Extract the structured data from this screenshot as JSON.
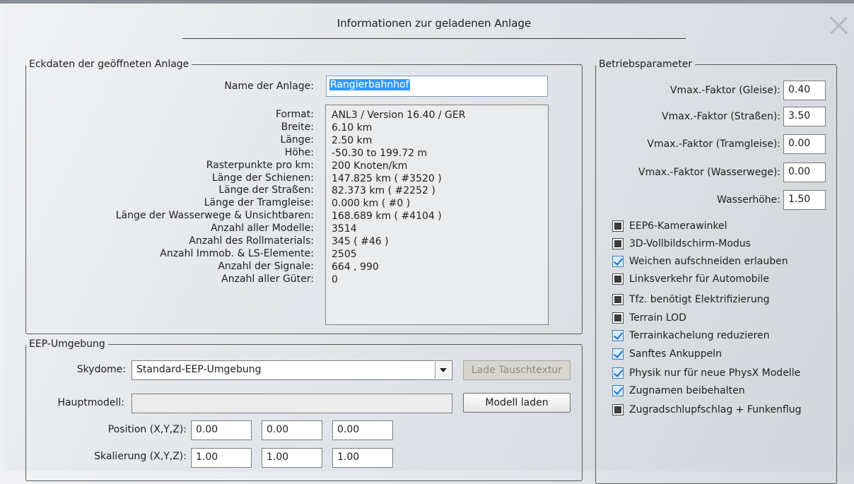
{
  "dialog": {
    "title": "Informationen zur geladenen Anlage"
  },
  "eckdaten": {
    "legend": "Eckdaten der geöffneten Anlage",
    "name_label": "Name der Anlage:",
    "name_value": "Rangierbahnhof",
    "rows": [
      {
        "label": "Format:",
        "value": "ANL3 / Version 16.40 / GER"
      },
      {
        "label": "Breite:",
        "value": "6.10 km"
      },
      {
        "label": "Länge:",
        "value": "2.50 km"
      },
      {
        "label": "Höhe:",
        "value": "-50.30 to 199.72 m"
      },
      {
        "label": "Rasterpunkte pro km:",
        "value": "200 Knoten/km"
      },
      {
        "label": "Länge der Schienen:",
        "value": "147.825 km ( #3520 )"
      },
      {
        "label": "Länge der Straßen:",
        "value": "82.373 km ( #2252 )"
      },
      {
        "label": "Länge der Tramgleise:",
        "value": "0.000 km ( #0 )"
      },
      {
        "label": "Länge der Wasserwege & Unsichtbaren:",
        "value": "168.689 km ( #4104 )"
      },
      {
        "label": "Anzahl aller Modelle:",
        "value": "3514"
      },
      {
        "label": "Anzahl des Rollmaterials:",
        "value": "345 ( #46 )"
      },
      {
        "label": "Anzahl Immob. & LS-Elemente:",
        "value": "2505"
      },
      {
        "label": "Anzahl der Signale:",
        "value": "664 , 990"
      },
      {
        "label": "Anzahl aller Güter:",
        "value": "0"
      }
    ]
  },
  "eep": {
    "legend": "EEP-Umgebung",
    "skydome_label": "Skydome:",
    "skydome_value": "Standard-EEP-Umgebung",
    "lade_button": "Lade Tauschtextur",
    "hauptmodell_label": "Hauptmodell:",
    "hauptmodell_value": "",
    "modell_button": "Modell laden",
    "position_label": "Position (X,Y,Z):",
    "position": [
      "0.00",
      "0.00",
      "0.00"
    ],
    "skalierung_label": "Skalierung (X,Y,Z):",
    "skalierung": [
      "1.00",
      "1.00",
      "1.00"
    ]
  },
  "betrieb": {
    "legend": "Betriebsparameter",
    "params": [
      {
        "label": "Vmax.-Faktor (Gleise):",
        "value": "0.40"
      },
      {
        "label": "Vmax.-Faktor (Straßen):",
        "value": "3.50"
      },
      {
        "label": "Vmax.-Faktor (Tramgleise):",
        "value": "0.00"
      },
      {
        "label": "Vmax.-Faktor (Wasserwege):",
        "value": "0.00"
      },
      {
        "label": "Wasserhöhe:",
        "value": "1.50"
      }
    ],
    "checkboxes": [
      {
        "label": "EEP6-Kamerawinkel",
        "checked": false
      },
      {
        "label": "3D-Vollbildschirm-Modus",
        "checked": false
      },
      {
        "label": "Weichen aufschneiden erlauben",
        "checked": true
      },
      {
        "label": "Linksverkehr für Automobile",
        "checked": false
      },
      {
        "label": "Tfz. benötigt Elektrifizierung",
        "checked": false
      },
      {
        "label": "Terrain LOD",
        "checked": false
      },
      {
        "label": "Terrainkachelung reduzieren",
        "checked": true
      },
      {
        "label": "Sanftes Ankuppeln",
        "checked": true
      },
      {
        "label": "Physik nur für neue PhysX Modelle",
        "checked": true
      },
      {
        "label": "Zugnamen beibehalten",
        "checked": true
      },
      {
        "label": "Zugradschlupfschlag + Funkenflug",
        "checked": false
      }
    ]
  }
}
